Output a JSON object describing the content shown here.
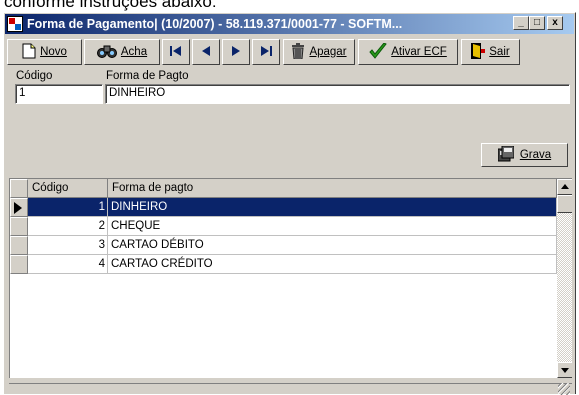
{
  "page_caption": "conforme instruções abaixo:",
  "window": {
    "title": "Forma de Pagamento| (10/2007) - 58.119.371/0001-77 - SOFTM...",
    "minimize": "_",
    "maximize": "□",
    "close": "x"
  },
  "toolbar": {
    "novo": "Novo",
    "acha": "Acha",
    "apagar": "Apagar",
    "ativar_ecf": "Ativar ECF",
    "sair": "Sair"
  },
  "form": {
    "codigo_label": "Código",
    "codigo_value": "1",
    "forma_label": "Forma de Pagto",
    "forma_value": "DINHEIRO",
    "grava_label": "Grava"
  },
  "grid": {
    "columns": [
      "Código",
      "Forma de pagto"
    ],
    "rows": [
      {
        "codigo": "1",
        "forma": "DINHEIRO"
      },
      {
        "codigo": "2",
        "forma": "CHEQUE"
      },
      {
        "codigo": "3",
        "forma": "CARTAO DÉBITO"
      },
      {
        "codigo": "4",
        "forma": "CARTAO CRÉDITO"
      }
    ],
    "selected_row": 0
  },
  "colors": {
    "title_start": "#0a246a",
    "title_end": "#a6caf0",
    "selection": "#0a246a",
    "face": "#d4d0c8"
  }
}
